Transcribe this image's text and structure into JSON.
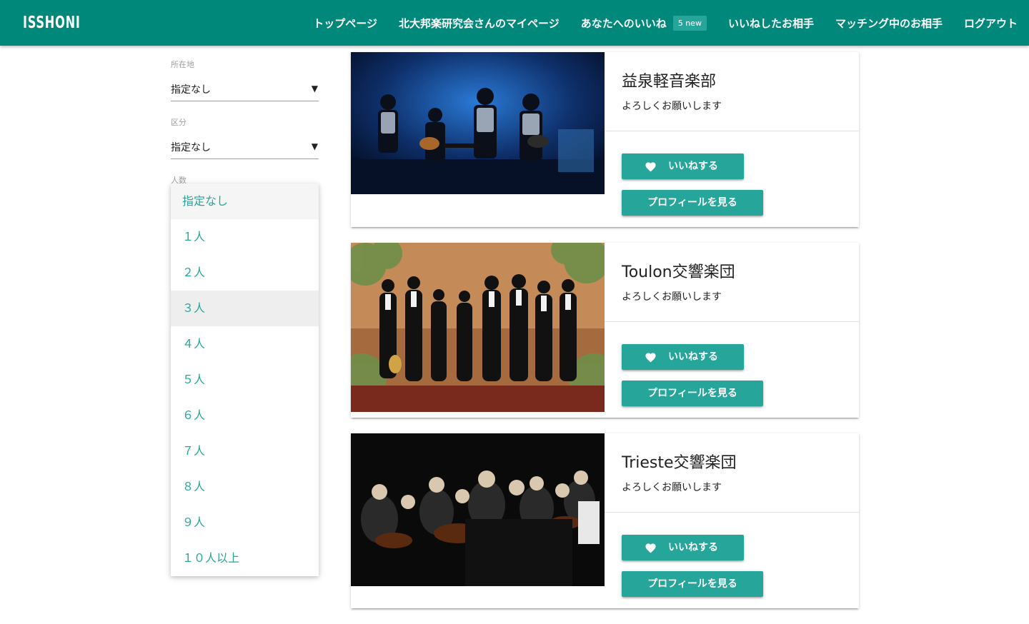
{
  "nav": {
    "brand": "ISSHONI",
    "links": [
      {
        "label": "トップページ"
      },
      {
        "label": "北大邦楽研究会さんのマイページ"
      },
      {
        "label": "あなたへのいいね",
        "badge": "5 new"
      },
      {
        "label": "いいねしたお相手"
      },
      {
        "label": "マッチング中のお相手"
      },
      {
        "label": "ログアウト"
      }
    ]
  },
  "filters": {
    "location": {
      "label": "所在地",
      "value": "指定なし"
    },
    "category": {
      "label": "区分",
      "value": "指定なし"
    },
    "members": {
      "label": "人数",
      "value": "指定なし"
    }
  },
  "dropdown": {
    "options": [
      "指定なし",
      "１人",
      "２人",
      "３人",
      "４人",
      "５人",
      "６人",
      "７人",
      "８人",
      "９人",
      "１０人以上"
    ],
    "selected": "指定なし",
    "hovered": "３人"
  },
  "cards": [
    {
      "title": "益泉軽音楽部",
      "message": "よろしくお願いします",
      "like_label": "いいねする",
      "profile_label": "プロフィールを見る",
      "image": "rock-band-live-photo"
    },
    {
      "title": "Toulon交響楽団",
      "message": "よろしくお願いします",
      "like_label": "いいねする",
      "profile_label": "プロフィールを見る",
      "image": "ensemble-group-photo"
    },
    {
      "title": "Trieste交響楽団",
      "message": "よろしくお願いします",
      "like_label": "いいねする",
      "profile_label": "プロフィールを見る",
      "image": "orchestra-performance-photo"
    }
  ],
  "colors": {
    "primary": "#00897b",
    "accent": "#26a69a",
    "badge": "#26a69a"
  },
  "icons": {
    "dropdown_caret": "▼",
    "like": "heart-icon"
  }
}
